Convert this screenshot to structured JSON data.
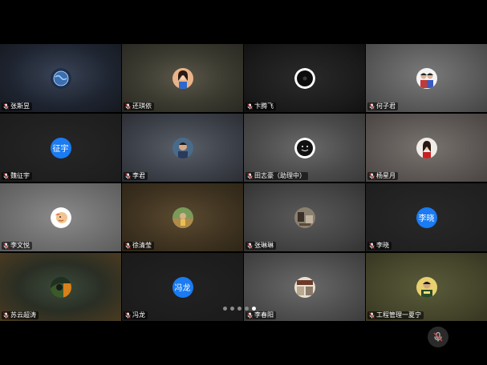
{
  "participants": [
    {
      "name": "张斯昱",
      "avatar_text": "",
      "avatar_kind": "globe"
    },
    {
      "name": "还琪依",
      "avatar_text": "",
      "avatar_kind": "photo-woman"
    },
    {
      "name": "卞腾飞",
      "avatar_text": "",
      "avatar_kind": "dark-disc"
    },
    {
      "name": "何子君",
      "avatar_text": "",
      "avatar_kind": "photo-couple"
    },
    {
      "name": "魏征宇",
      "avatar_text": "征宇",
      "avatar_kind": "text"
    },
    {
      "name": "李君",
      "avatar_text": "",
      "avatar_kind": "photo-man"
    },
    {
      "name": "田志豪（助理中）",
      "avatar_text": "",
      "avatar_kind": "smiley"
    },
    {
      "name": "杨星月",
      "avatar_text": "",
      "avatar_kind": "photo-woman2"
    },
    {
      "name": "李文悦",
      "avatar_text": "",
      "avatar_kind": "cartoon"
    },
    {
      "name": "徐清莹",
      "avatar_text": "",
      "avatar_kind": "photo-outdoor"
    },
    {
      "name": "张琳琳",
      "avatar_text": "",
      "avatar_kind": "photo-room"
    },
    {
      "name": "李晓",
      "avatar_text": "李晓",
      "avatar_kind": "text"
    },
    {
      "name": "苏云超涛",
      "avatar_text": "",
      "avatar_kind": "photo-dark"
    },
    {
      "name": "冯龙",
      "avatar_text": "冯龙",
      "avatar_kind": "text"
    },
    {
      "name": "李春阳",
      "avatar_text": "",
      "avatar_kind": "photo-shop"
    },
    {
      "name": "工程管理一夏宁",
      "avatar_text": "",
      "avatar_kind": "photo-sign"
    }
  ],
  "pagination": {
    "pages": 5,
    "current": 5
  },
  "controls": {
    "mute_icon": "mic-muted-icon"
  },
  "colors": {
    "accent": "#1a7bf2",
    "mute": "#e0403a"
  }
}
